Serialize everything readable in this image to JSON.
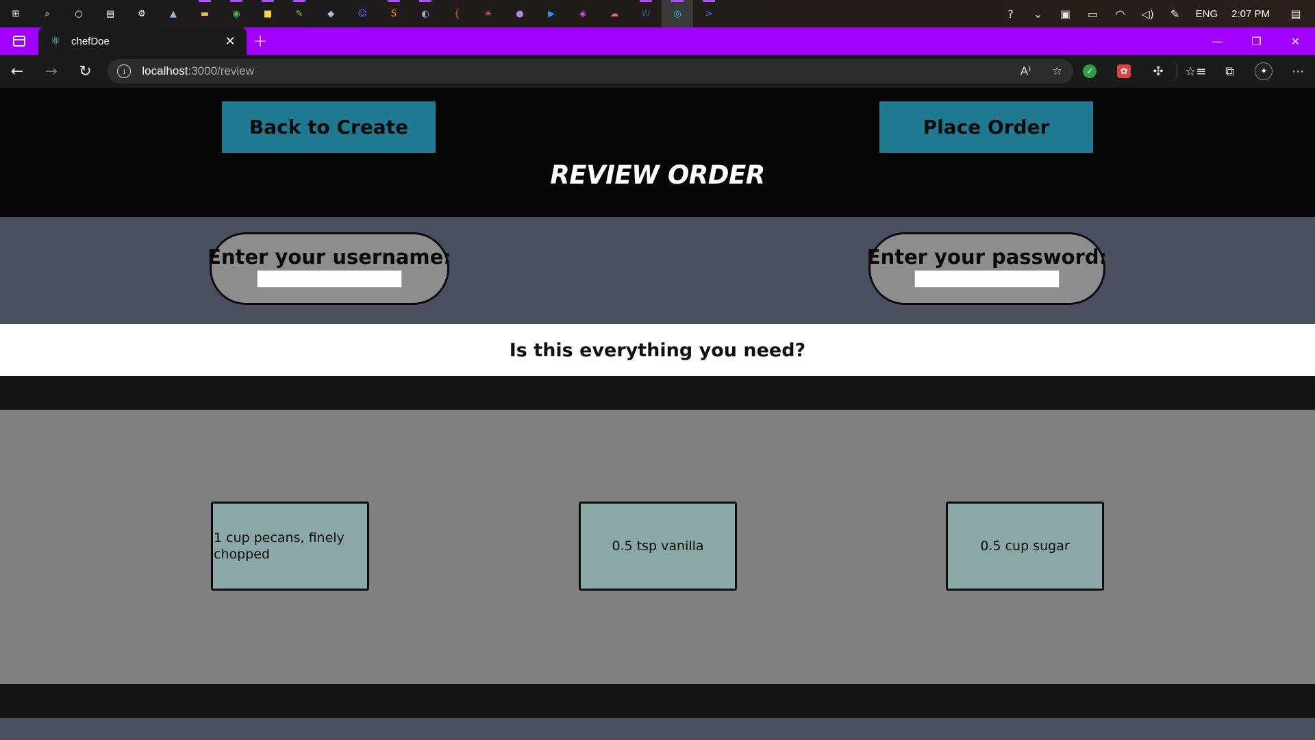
{
  "taskbar": {
    "apps": [
      {
        "name": "windows-start-icon",
        "glyph": "⊞",
        "color": "#ffffff"
      },
      {
        "name": "search-icon",
        "glyph": "⌕",
        "color": "#ffffff"
      },
      {
        "name": "cortana-icon",
        "glyph": "○",
        "color": "#ffffff"
      },
      {
        "name": "task-view-icon",
        "glyph": "▤",
        "color": "#ffffff"
      },
      {
        "name": "settings-icon",
        "glyph": "⚙",
        "color": "#ffffff"
      },
      {
        "name": "photos-icon",
        "glyph": "▲",
        "color": "#8fb8d8"
      },
      {
        "name": "file-explorer-icon",
        "glyph": "▬",
        "color": "#f0c040"
      },
      {
        "name": "chrome-icon",
        "glyph": "◉",
        "color": "#4caf50"
      },
      {
        "name": "sticky-notes-icon",
        "glyph": "■",
        "color": "#f7d547"
      },
      {
        "name": "notepad-icon",
        "glyph": "✎",
        "color": "#8bc34a"
      },
      {
        "name": "app-icon",
        "glyph": "◆",
        "color": "#9ec6e8"
      },
      {
        "name": "discord-icon",
        "glyph": "☺",
        "color": "#5865f2"
      },
      {
        "name": "sublime-icon",
        "glyph": "S",
        "color": "#ff9800"
      },
      {
        "name": "app-icon-2",
        "glyph": "◐",
        "color": "#9fa8da"
      },
      {
        "name": "brackets-icon",
        "glyph": "{",
        "color": "#ff6a00"
      },
      {
        "name": "network-icon",
        "glyph": "✳",
        "color": "#e57373"
      },
      {
        "name": "github-icon",
        "glyph": "●",
        "color": "#bb86fc"
      },
      {
        "name": "zoom-icon",
        "glyph": "▶",
        "color": "#2d8cff"
      },
      {
        "name": "paint-icon",
        "glyph": "◈",
        "color": "#e040fb"
      },
      {
        "name": "cloud-icon",
        "glyph": "☁",
        "color": "#f06292"
      },
      {
        "name": "word-icon",
        "glyph": "W",
        "color": "#2b579a"
      },
      {
        "name": "edge-icon",
        "glyph": "◎",
        "color": "#2fc4e6"
      },
      {
        "name": "terminal-icon",
        "glyph": ">",
        "color": "#3b78ff"
      }
    ],
    "tray": {
      "language": "ENG",
      "time": "2:07 PM"
    }
  },
  "browser": {
    "tab_title": "chefDoe",
    "tab_favicon": "⚛",
    "new_tab": "+",
    "url_host": "localhost",
    "url_path": ":3000/review"
  },
  "page": {
    "back_button": "Back to Create",
    "place_button": "Place Order",
    "title": "REVIEW ORDER",
    "username_label": "Enter your username:",
    "username_value": "",
    "password_label": "Enter your password:",
    "password_value": "",
    "question": "Is this everything you need?",
    "items": [
      "1 cup pecans, finely chopped",
      "0.5 tsp vanilla",
      "0.5 cup sugar"
    ]
  },
  "colors": {
    "tab_strip": "#a200ff",
    "button": "#1f7a91",
    "credentials_band": "#495060",
    "items_area": "#808080",
    "card": "#8aa8a8"
  }
}
